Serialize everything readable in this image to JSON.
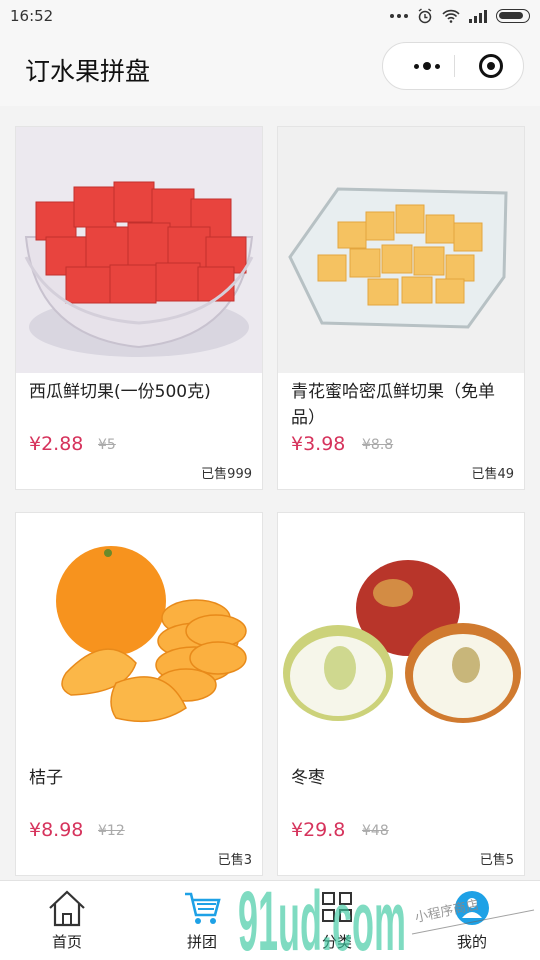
{
  "status": {
    "time": "16:52"
  },
  "header": {
    "title": "订水果拼盘"
  },
  "capsule": {
    "more_icon": "more-dots-icon",
    "close_icon": "target-close-icon"
  },
  "products": [
    {
      "name": "西瓜鲜切果(一份500克)",
      "price": "¥2.88",
      "original_price": "¥5",
      "sold": "已售999"
    },
    {
      "name": "青花蜜哈密瓜鲜切果（免单品）",
      "price": "¥3.98",
      "original_price": "¥8.8",
      "sold": "已售49"
    },
    {
      "name": "桔子",
      "price": "¥8.98",
      "original_price": "¥12",
      "sold": "已售3"
    },
    {
      "name": "冬枣",
      "price": "¥29.8",
      "original_price": "¥48",
      "sold": "已售5"
    }
  ],
  "tabs": [
    {
      "label": "首页",
      "icon": "home-icon"
    },
    {
      "label": "拼团",
      "icon": "cart-icon"
    },
    {
      "label": "分类",
      "icon": "grid-icon"
    },
    {
      "label": "我的",
      "icon": "user-icon"
    }
  ],
  "watermark": {
    "logo": "91ud.com",
    "caption": "小程序商店"
  },
  "colors": {
    "price": "#d6335c",
    "accent": "#1ea1e6",
    "watermark": "#3cc9a0"
  }
}
